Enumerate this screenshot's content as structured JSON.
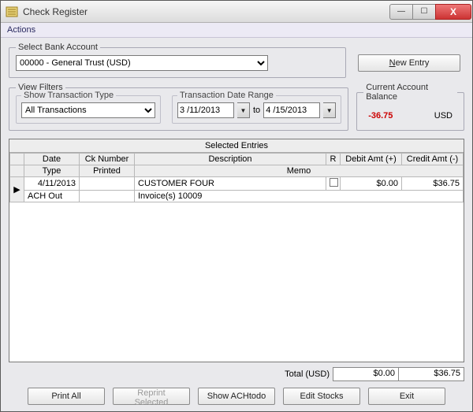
{
  "window": {
    "title": "Check Register"
  },
  "menubar": {
    "actions": "Actions"
  },
  "bank": {
    "legend": "Select Bank Account",
    "selected": "00000 - General Trust (USD)"
  },
  "new_entry": {
    "pre": "",
    "u": "N",
    "post": "ew Entry"
  },
  "filters": {
    "legend": "View Filters",
    "type_label": "Show Transaction Type",
    "type_selected": "All Transactions",
    "range_label": "Transaction Date Range",
    "from": "3 /11/2013",
    "to_word": "to",
    "to": "4 /15/2013"
  },
  "balance": {
    "legend": "Current Account Balance",
    "value": "-36.75",
    "currency": "USD"
  },
  "grid": {
    "title": "Selected Entries",
    "hdr1": {
      "date": "Date",
      "ck": "Ck Number",
      "desc": "Description",
      "r": "R",
      "debit": "Debit Amt (+)",
      "credit": "Credit Amt (-)"
    },
    "hdr2": {
      "type": "Type",
      "printed": "Printed",
      "memo": "Memo"
    },
    "row1": {
      "date": "4/11/2013",
      "ck": "",
      "desc": "CUSTOMER FOUR",
      "debit": "$0.00",
      "credit": "$36.75"
    },
    "row2": {
      "type": "ACH Out",
      "printed": "",
      "memo": "Invoice(s) 10009"
    },
    "pointer": "▶"
  },
  "totals": {
    "label": "Total (USD)",
    "debit": "$0.00",
    "credit": "$36.75"
  },
  "buttons": {
    "print_all": "Print All",
    "reprint": "Reprint Selected",
    "ach": "Show ACHtodo",
    "edit": "Edit Stocks",
    "exit": "Exit"
  },
  "icons": {
    "minimize": "—",
    "maximize": "☐",
    "close": "X",
    "dropdown": "▼"
  }
}
